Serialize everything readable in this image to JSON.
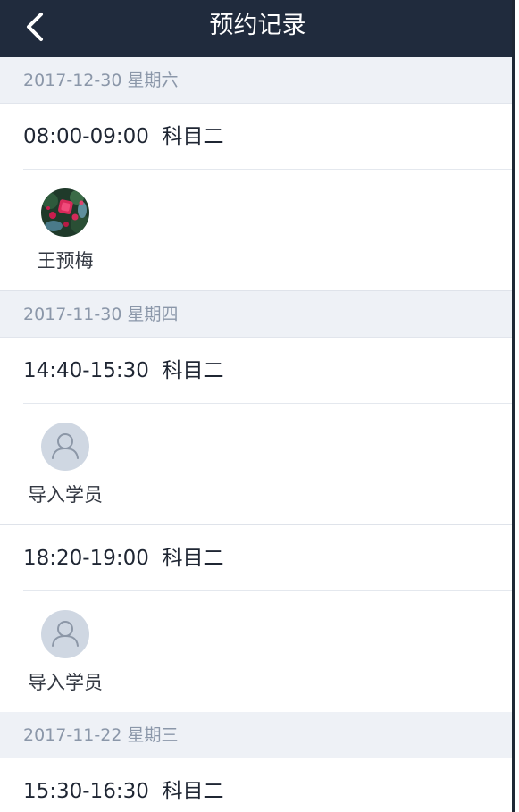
{
  "header": {
    "title": "预约记录",
    "back_icon": "chevron-left-icon"
  },
  "groups": [
    {
      "date": "2017-12-30 星期六",
      "appointments": [
        {
          "time": "08:00-09:00",
          "subject": "科目二",
          "slot": "08:00-09:00  科目二",
          "student": "王预梅",
          "avatar": "photo"
        }
      ]
    },
    {
      "date": "2017-11-30 星期四",
      "appointments": [
        {
          "time": "14:40-15:30",
          "subject": "科目二",
          "slot": "14:40-15:30  科目二",
          "student": "导入学员",
          "avatar": "user-icon"
        },
        {
          "time": "18:20-19:00",
          "subject": "科目二",
          "slot": "18:20-19:00  科目二",
          "student": "导入学员",
          "avatar": "user-icon"
        }
      ]
    },
    {
      "date": "2017-11-22 星期三",
      "appointments": [
        {
          "time": "15:30-16:30",
          "subject": "科目二",
          "slot": "15:30-16:30  科目二"
        }
      ]
    }
  ],
  "colors": {
    "header_bg": "#202b3d",
    "date_bar_bg": "#eef1f6",
    "date_text": "#8b97a9",
    "avatar_placeholder": "#cfd7e2"
  }
}
